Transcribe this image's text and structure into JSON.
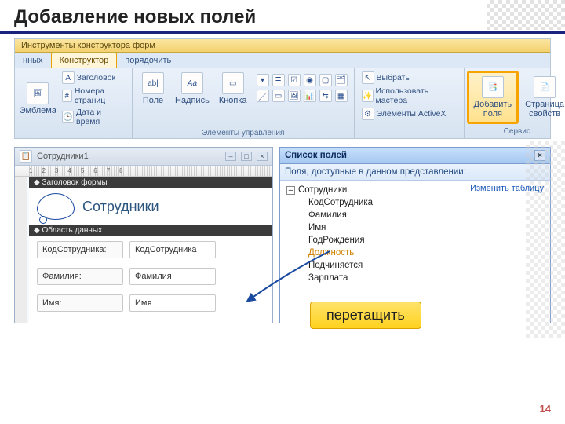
{
  "slide": {
    "title": "Добавление новых полей",
    "page": "14"
  },
  "ribbon": {
    "context_tab": "Инструменты конструктора форм",
    "tabs": {
      "left_frag": "нных",
      "active": "Конструктор",
      "arrange": "порядочить"
    },
    "group1": {
      "emblem": "Эмблема",
      "header": "Заголовок",
      "pagenum": "Номера страниц",
      "datetime": "Дата и время"
    },
    "group2": {
      "field": "Поле",
      "label_ctl": "Надпись",
      "button": "Кнопка",
      "aa": "Aa",
      "ab": "ab|",
      "group_label": "Элементы управления"
    },
    "group3": {
      "select": "Выбрать",
      "use_wizard": "Использовать мастера",
      "activex": "Элементы ActiveX"
    },
    "group4": {
      "addfields": "Добавить\nполя",
      "propsheet": "Страница\nсвойств",
      "group_label": "Сервис"
    }
  },
  "formwin": {
    "title": "Сотрудники1",
    "ruler_marks": [
      "1",
      "2",
      "3",
      "4",
      "5",
      "6",
      "7",
      "8"
    ],
    "header_section": "Заголовок формы",
    "form_title": "Сотрудники",
    "data_section": "Область данных",
    "rows": [
      {
        "label": "КодСотрудника:",
        "bound": "КодСотрудника"
      },
      {
        "label": "Фамилия:",
        "bound": "Фамилия"
      },
      {
        "label": "Имя:",
        "bound": "Имя"
      }
    ]
  },
  "fieldlist": {
    "title": "Список полей",
    "subtitle": "Поля, доступные в данном представлении:",
    "edit_link": "Изменить таблицу",
    "table": "Сотрудники",
    "fields": [
      "КодСотрудника",
      "Фамилия",
      "Имя",
      "ГодРождения",
      "Должность",
      "Подчиняется",
      "Зарплата"
    ],
    "highlight_index": 4
  },
  "callout": {
    "text": "перетащить"
  }
}
